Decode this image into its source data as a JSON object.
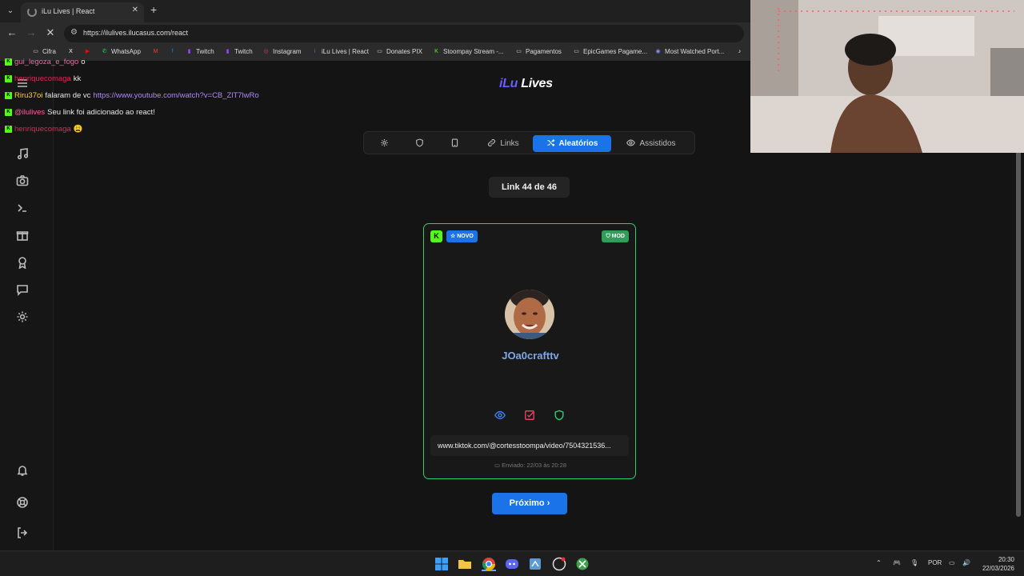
{
  "browser": {
    "tab_title": "iLu Lives | React",
    "url": "https://ilulives.ilucasus.com/react",
    "bookmarks": [
      {
        "label": "Cifra",
        "icon": "folder-icon",
        "color": "#cccccc"
      },
      {
        "label": "",
        "icon": "x-icon",
        "color": "#ffffff"
      },
      {
        "label": "",
        "icon": "youtube-icon",
        "color": "#ff0000"
      },
      {
        "label": "WhatsApp",
        "icon": "whatsapp-icon",
        "color": "#25d366"
      },
      {
        "label": "",
        "icon": "gmail-icon",
        "color": "#ea4335"
      },
      {
        "label": "",
        "icon": "facebook-icon",
        "color": "#1877f2"
      },
      {
        "label": "Twitch",
        "icon": "twitch-icon",
        "color": "#9146ff"
      },
      {
        "label": "Twitch",
        "icon": "twitch-icon",
        "color": "#9146ff"
      },
      {
        "label": "Instagram",
        "icon": "instagram-icon",
        "color": "#e1306c"
      },
      {
        "label": "iLu Lives | React",
        "icon": "ilu-icon",
        "color": "#6a5cff"
      },
      {
        "label": "Donates PIX",
        "icon": "folder-icon",
        "color": "#cccccc"
      },
      {
        "label": "Stoompay Stream -...",
        "icon": "kick-icon",
        "color": "#53fc18"
      },
      {
        "label": "Pagamentos",
        "icon": "folder-icon",
        "color": "#cccccc"
      },
      {
        "label": "EpicGames Pagame...",
        "icon": "folder-icon",
        "color": "#cccccc"
      },
      {
        "label": "Most Watched Port...",
        "icon": "globe-icon",
        "color": "#8888ff"
      },
      {
        "label": "",
        "icon": "tiktok-icon",
        "color": "#ffffff"
      }
    ]
  },
  "app": {
    "logo_prefix": "iLu",
    "logo_suffix": "Lives",
    "tabs": [
      {
        "label": "",
        "icon": "gear-icon",
        "active": false
      },
      {
        "label": "",
        "icon": "shield-icon",
        "active": false
      },
      {
        "label": "",
        "icon": "tablet-icon",
        "active": false
      },
      {
        "label": "Links",
        "icon": "link-icon",
        "active": false
      },
      {
        "label": "Aleatórios",
        "icon": "shuffle-icon",
        "active": true
      },
      {
        "label": "Assistidos",
        "icon": "eye-icon",
        "active": false
      }
    ],
    "counter": "Link 44 de 46",
    "card": {
      "badge_novo": "☆ NOVO",
      "badge_mod": "MOD",
      "username": "JOa0crafttv",
      "link": "www.tiktok.com/@cortesstoompa/video/7504321536...",
      "sent": "Enviado: 22/03 às 20:28"
    },
    "next_button": "Próximo ›",
    "accent": "#1a73e8",
    "card_border": "#2ecc71"
  },
  "chat": [
    {
      "user": "gui_legoza_e_fogo",
      "user_color": "#ff5ea0",
      "text": "o"
    },
    {
      "user": "henriquecomaga",
      "user_color": "#e0245e",
      "text": "kk"
    },
    {
      "user": "Riru37oi",
      "user_color": "#ffd21f",
      "text": "falaram de vc",
      "link": "https://www.youtube.com/watch?v=CB_ZlT7lwRo"
    },
    {
      "user": "@ilulives",
      "user_color": "#ff5ea0",
      "text": "Seu link foi adicionado ao react!"
    },
    {
      "user": "henriquecomaga",
      "user_color": "#e0245e",
      "text": "😩"
    }
  ],
  "taskbar": {
    "language": "POR",
    "time": "20:30",
    "date": "22/03/2026"
  }
}
